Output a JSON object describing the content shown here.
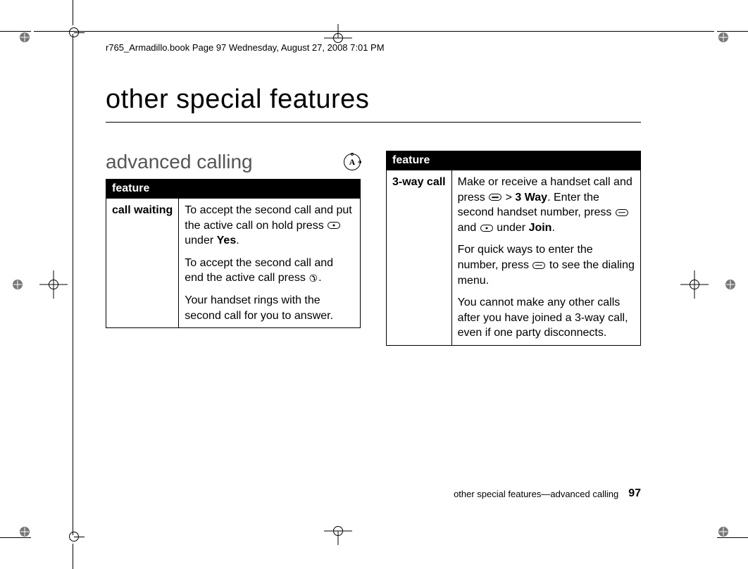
{
  "header": {
    "running": "r765_Armadillo.book  Page 97  Wednesday, August 27, 2008  7:01 PM"
  },
  "chapter_title": "other special features",
  "section_title": "advanced calling",
  "section_icon_letter": "A",
  "left_table": {
    "header": "feature",
    "row_name": "call waiting",
    "p1_a": "To accept the second call and put the active call on hold press ",
    "p1_b": " under ",
    "p1_yes": "Yes",
    "p1_c": ".",
    "p2_a": "To accept the second call and end the active call press ",
    "p2_b": ".",
    "p3": "Your handset rings with the second call for you to answer."
  },
  "right_table": {
    "header": "feature",
    "row_name": "3-way call",
    "p1_a": "Make or receive a handset call and press ",
    "p1_b": " > ",
    "p1_3way": "3 Way",
    "p1_c": ". Enter the second handset number, press ",
    "p1_d": " and ",
    "p1_e": " under ",
    "p1_join": "Join",
    "p1_f": ".",
    "p2_a": "For quick ways to enter the number, press ",
    "p2_b": " to see the dialing menu.",
    "p3": "You cannot make any other calls after you have joined a 3-way call, even if one party disconnects."
  },
  "footer": {
    "text": "other special features—advanced calling",
    "page": "97"
  }
}
